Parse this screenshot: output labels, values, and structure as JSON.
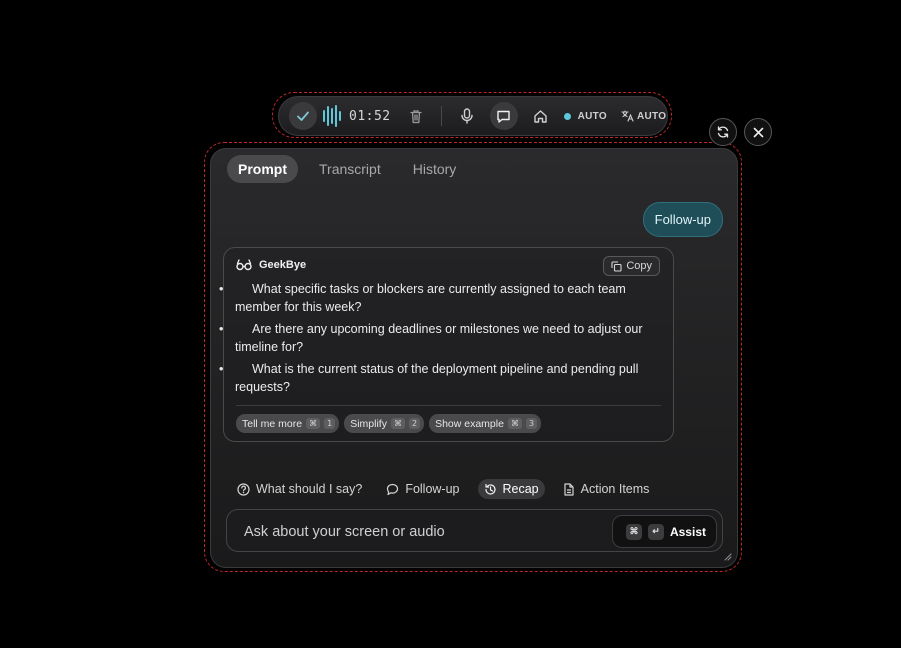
{
  "toolbar": {
    "timer": "01:52",
    "auto_label": "AUTO",
    "lang_auto_label": "AUTO",
    "accent_color": "#5cc8da"
  },
  "tabs": [
    {
      "label": "Prompt",
      "active": true
    },
    {
      "label": "Transcript",
      "active": false
    },
    {
      "label": "History",
      "active": false
    }
  ],
  "followup_chip": "Follow-up",
  "response": {
    "brand": "GeekBye",
    "copy_label": "Copy",
    "bullets": [
      "What specific tasks or blockers are currently assigned to each team member for this week?",
      "Are there any upcoming deadlines or milestones we need to adjust our timeline for?",
      "What is the current status of the deployment pipeline and pending pull requests?"
    ],
    "suggestions": [
      {
        "label": "Tell me more",
        "mod": "⌘",
        "key": "1"
      },
      {
        "label": "Simplify",
        "mod": "⌘",
        "key": "2"
      },
      {
        "label": "Show example",
        "mod": "⌘",
        "key": "3"
      }
    ]
  },
  "actions": [
    {
      "label": "What should I say?",
      "icon": "help-circle-icon"
    },
    {
      "label": "Follow-up",
      "icon": "chat-bubble-icon"
    },
    {
      "label": "Recap",
      "icon": "rewind-icon",
      "active": true
    },
    {
      "label": "Action Items",
      "icon": "document-icon"
    }
  ],
  "input": {
    "placeholder": "Ask about your screen or audio",
    "assist_mod": "⌘",
    "assist_key": "↵",
    "assist_label": "Assist"
  }
}
